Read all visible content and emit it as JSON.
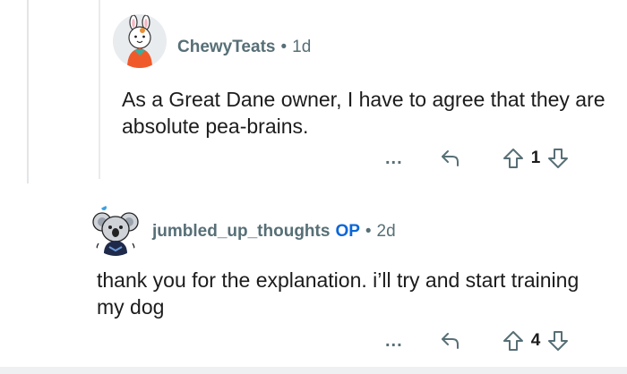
{
  "comments": [
    {
      "username": "ChewyTeats",
      "separator": "•",
      "time": "1d",
      "body": "As a Great Dane owner, I have to agree that they are absolute pea-brains.",
      "more_label": "...",
      "votes": "1",
      "op_badge": ""
    },
    {
      "username": "jumbled_up_thoughts",
      "op_badge": "OP",
      "separator": "•",
      "time": "2d",
      "body": "thank you for the explanation. i’ll try and start training my dog",
      "more_label": "...",
      "votes": "4"
    }
  ],
  "colors": {
    "meta_text": "#576f76",
    "op_badge": "#0a66d8",
    "body_text": "#1c1c1c",
    "thread_line": "#e3e5e8"
  },
  "icons": [
    "reply-icon",
    "upvote-icon",
    "downvote-icon",
    "more-options-icon"
  ]
}
